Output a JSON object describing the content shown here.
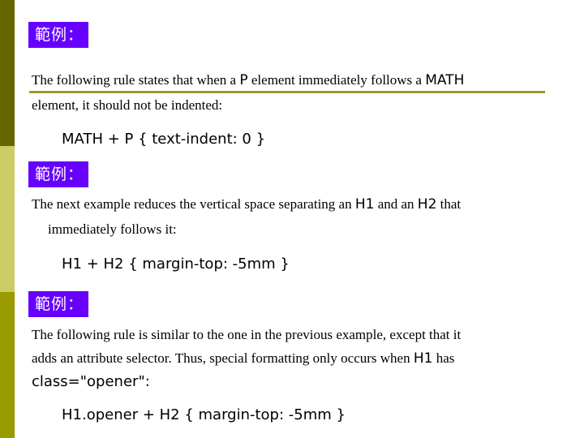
{
  "colors": {
    "sidebar_top": "#666600",
    "sidebar_middle": "#CCCC66",
    "sidebar_bottom": "#999900",
    "badge_bg": "#6600FF",
    "rule": "#999933"
  },
  "examples": [
    {
      "badge": "範例：",
      "lines": [
        [
          "The following rule states that when a ",
          "P",
          " element immediately follows a ",
          "MATH"
        ],
        [
          "element, it should not be indented:"
        ]
      ],
      "code": "MATH + P { text-indent: 0 }"
    },
    {
      "badge": "範例：",
      "lines": [
        [
          "The next example reduces the vertical space separating an ",
          "H1",
          " and an ",
          "H2",
          " that"
        ],
        [
          "immediately follows it:"
        ]
      ],
      "code": "H1 + H2 { margin-top: -5mm }"
    },
    {
      "badge": "範例：",
      "lines": [
        [
          "The following rule is similar to the one in the previous example, except that it"
        ],
        [
          "adds an attribute selector. Thus, special formatting only occurs when ",
          "H1",
          " has"
        ],
        [
          "",
          "class=\"opener\":"
        ]
      ],
      "code": "H1.opener + H2 { margin-top: -5mm }"
    }
  ]
}
